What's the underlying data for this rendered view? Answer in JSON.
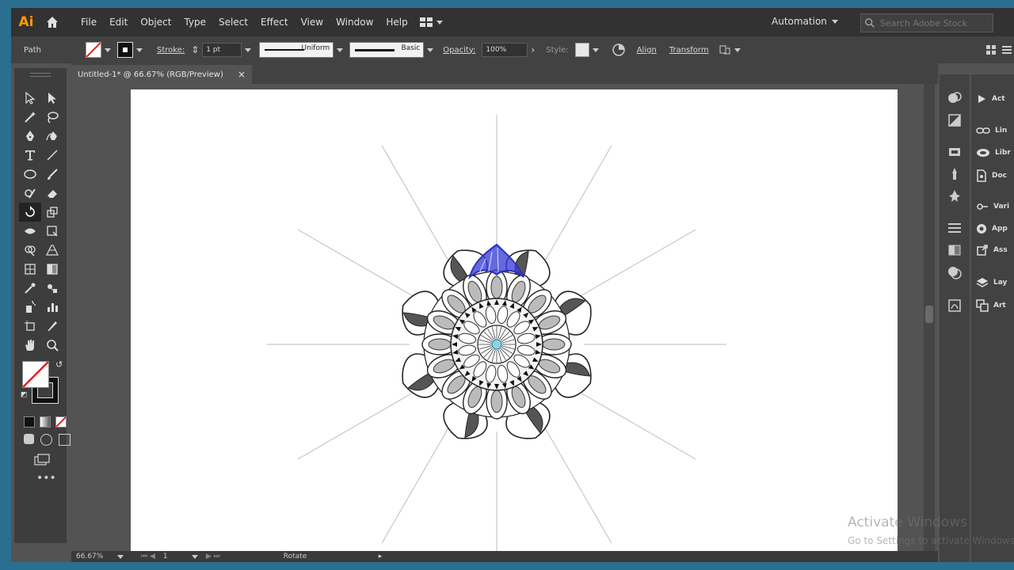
{
  "app": {
    "logo": "Ai"
  },
  "menu": [
    "File",
    "Edit",
    "Object",
    "Type",
    "Select",
    "Effect",
    "View",
    "Window",
    "Help"
  ],
  "workspace": "Automation",
  "search": {
    "placeholder": "Search Adobe Stock"
  },
  "control": {
    "selection": "Path",
    "stroke_label": "Stroke:",
    "stroke_weight": "1 pt",
    "profile": "Uniform",
    "brush": "Basic",
    "opacity_label": "Opacity:",
    "opacity": "100%",
    "style_label": "Style:",
    "align": "Align",
    "transform": "Transform"
  },
  "document": {
    "tab_title": "Untitled-1* @ 66.67% (RGB/Preview)"
  },
  "status": {
    "zoom": "66.67%",
    "artboard": "1",
    "tool": "Rotate"
  },
  "panels": [
    {
      "label": "Act",
      "icon": "play-icon"
    },
    {
      "label": "Lin",
      "icon": "link-icon"
    },
    {
      "label": "Libr",
      "icon": "libraries-icon"
    },
    {
      "label": "Doc",
      "icon": "document-icon"
    },
    {
      "label": "Vari",
      "icon": "variables-icon"
    },
    {
      "label": "App",
      "icon": "appearance-icon"
    },
    {
      "label": "Ass",
      "icon": "asset-export-icon"
    },
    {
      "label": "Lay",
      "icon": "layers-icon"
    },
    {
      "label": "Art",
      "icon": "artboards-icon"
    }
  ],
  "watermark": {
    "line1": "Activate Windows",
    "line2": "Go to Settings to activate Windows."
  },
  "colors": {
    "accent": "#ff9a00",
    "selection_blue": "#3a3fd6",
    "guide": "#c8c8c8"
  }
}
